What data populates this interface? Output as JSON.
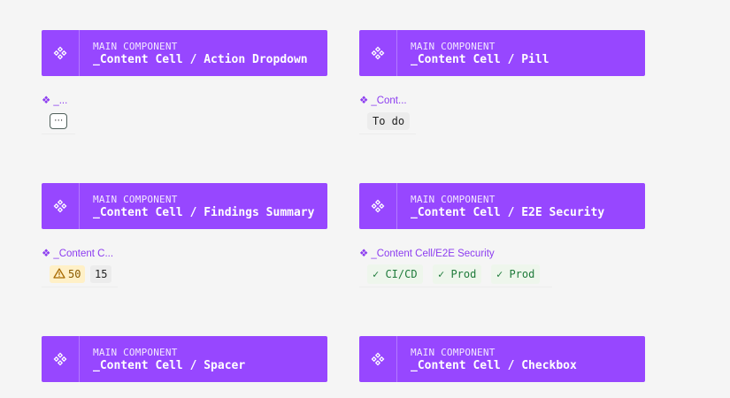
{
  "colors": {
    "banner_bg": "#9747ff",
    "label_purple": "#8c3cf0",
    "canvas_bg": "#f5f5f5",
    "warning_bg": "#fff0c7",
    "success_text": "#1e7a3a"
  },
  "icons": {
    "component": "component-diamond-icon",
    "warning": "warning-triangle-icon",
    "check": "check-icon"
  },
  "components": [
    {
      "kicker": "MAIN COMPONENT",
      "title": "_Content Cell / Action Dropdown"
    },
    {
      "kicker": "MAIN COMPONENT",
      "title": "_Content Cell / Pill"
    },
    {
      "kicker": "MAIN COMPONENT",
      "title": "_Content Cell / Findings Summary"
    },
    {
      "kicker": "MAIN COMPONENT",
      "title": "_Content Cell / E2E Security"
    },
    {
      "kicker": "MAIN COMPONENT",
      "title": "_Content Cell / Spacer"
    },
    {
      "kicker": "MAIN COMPONENT",
      "title": "_Content Cell / Checkbox"
    }
  ],
  "instances": {
    "action_dropdown": {
      "label": "_...",
      "button": "⋯"
    },
    "pill": {
      "label": "_Cont...",
      "text": "To do"
    },
    "findings": {
      "label": "_Content C...",
      "warning_count": "50",
      "other_count": "15"
    },
    "e2e": {
      "label": "_Content Cell/E2E Security",
      "badges": [
        "✓ CI/CD",
        "✓ Prod",
        "✓ Prod"
      ]
    }
  },
  "label_diamond": "❖"
}
